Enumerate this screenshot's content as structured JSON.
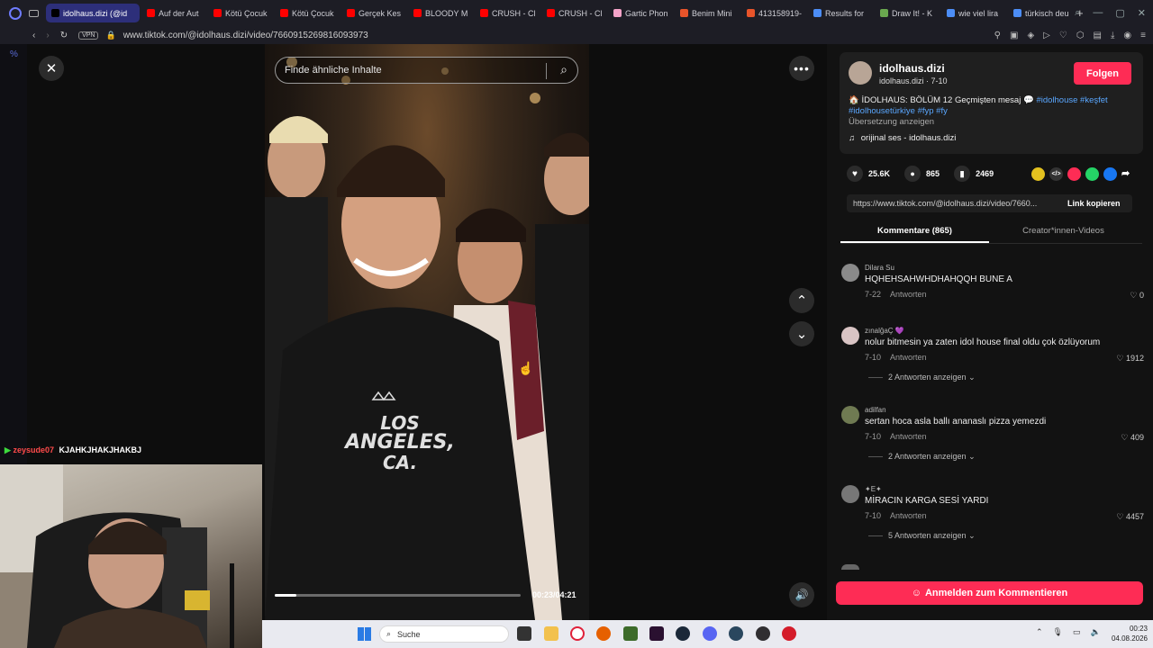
{
  "browser": {
    "tabs": [
      {
        "label": "idolhaus.dizi (@id",
        "active": true,
        "color": "#000000"
      },
      {
        "label": "Auf der Aut",
        "color": "#ff0000"
      },
      {
        "label": "Kötü Çocuk",
        "color": "#ff0000"
      },
      {
        "label": "Kötü Çocuk",
        "color": "#ff0000"
      },
      {
        "label": "Gerçek Kes",
        "color": "#ff0000"
      },
      {
        "label": "BLOODY M",
        "color": "#ff0000"
      },
      {
        "label": "CRUSH - Cl",
        "color": "#ff0000"
      },
      {
        "label": "CRUSH - Cl",
        "color": "#ff0000"
      },
      {
        "label": "Gartic Phon",
        "color": "#f4a3c8"
      },
      {
        "label": "Benim Mini",
        "color": "#e8542a"
      },
      {
        "label": "413158919-",
        "color": "#e8542a"
      },
      {
        "label": "Results for",
        "color": "#4c8df6"
      },
      {
        "label": "Draw It! - K",
        "color": "#6aa84f"
      },
      {
        "label": "wie viel lira",
        "color": "#4c8df6"
      },
      {
        "label": "türkisch deu",
        "color": "#4c8df6"
      }
    ],
    "vpn_label": "VPN",
    "url": "www.tiktok.com/@idolhaus.dizi/video/7660915269816093973"
  },
  "video": {
    "search_placeholder": "Finde ähnliche Inhalte",
    "time": "00:23/04:21",
    "progress": 0.088,
    "hoodie_text_1": "LOS",
    "hoodie_text_2": "ANGELES,",
    "hoodie_text_3": "CA."
  },
  "post": {
    "username": "idolhaus.dizi",
    "handle_date": "idolhaus.dizi · 7-10",
    "follow_label": "Folgen",
    "caption": "🏠 İDOLHAUS: BÖLÜM 12 Geçmişten mesaj 💬",
    "hashtags_1": "#idolhouse #keşfet",
    "hashtags_2": "#idolhousetürkiye #fyp #fy",
    "translate": "Übersetzung anzeigen",
    "music": "orijinal ses - idolhaus.dizi",
    "likes": "25.6K",
    "comments": "865",
    "saves": "2469",
    "link": "https://www.tiktok.com/@idolhaus.dizi/video/7660...",
    "copy_link": "Link kopieren",
    "tab_comments": "Kommentare (865)",
    "tab_creator": "Creator*innen-Videos",
    "login_comment": "Anmelden zum Kommentieren"
  },
  "comments": [
    {
      "user": "Dilara Su",
      "text": "HQHEHSAHWHDHAHQQH BUNE A",
      "date": "7-22",
      "reply": "Antworten",
      "likes": "0",
      "replies": ""
    },
    {
      "user": "zınalğaÇ 💜",
      "text": "nolur bitmesin ya zaten idol house final oldu çok özlüyorum",
      "date": "7-10",
      "reply": "Antworten",
      "likes": "1912",
      "replies": "2 Antworten anzeigen"
    },
    {
      "user": "adilfan",
      "text": "sertan hoca asla ballı ananaslı pizza yemezdi",
      "date": "7-10",
      "reply": "Antworten",
      "likes": "409",
      "replies": "2 Antworten anzeigen"
    },
    {
      "user": "✦E✦",
      "text": "MİRACIN KARGA SESİ YARDI",
      "date": "7-10",
      "reply": "Antworten",
      "likes": "4457",
      "replies": "5 Antworten anzeigen"
    }
  ],
  "chat": {
    "user": "zeysude07",
    "message": "KJAHKJHAKJHAKBJ"
  },
  "taskbar": {
    "search": "Suche",
    "time": "00:23",
    "date": "04.08.2026"
  },
  "colors": {
    "accent": "#fe2c55",
    "link": "#5aa7ff"
  }
}
